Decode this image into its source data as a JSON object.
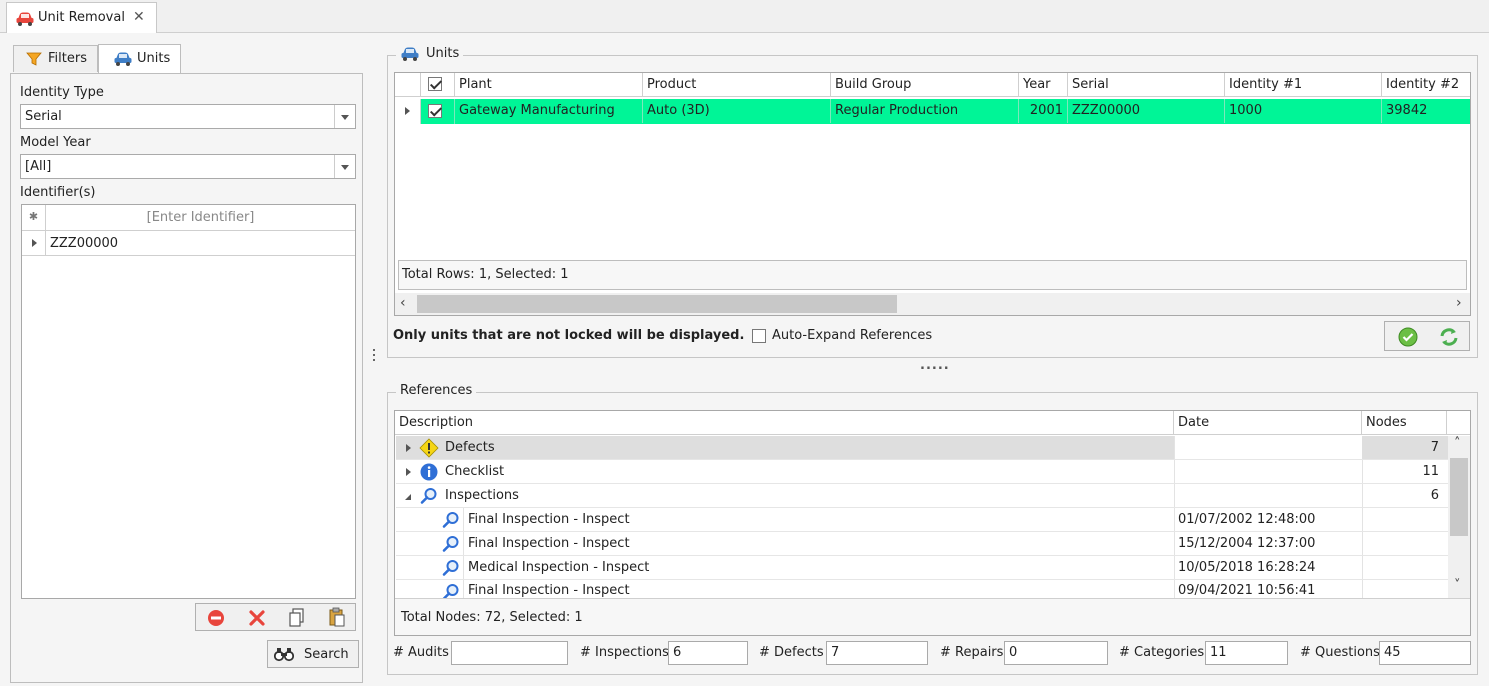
{
  "doc_tab": {
    "title": "Unit Removal",
    "close": "✕"
  },
  "left": {
    "tabs": {
      "filters": "Filters",
      "units": "Units"
    },
    "identity_type": {
      "label": "Identity Type",
      "value": "Serial"
    },
    "model_year": {
      "label": "Model Year",
      "value": "[All]"
    },
    "identifiers": {
      "label": "Identifier(s)",
      "new_row_marker": "✱",
      "placeholder": "[Enter Identifier]",
      "rows": [
        "ZZZ00000"
      ]
    },
    "search_label": "Search"
  },
  "units": {
    "title": "Units",
    "columns": [
      "Plant",
      "Product",
      "Build Group",
      "Year",
      "Serial",
      "Identity #1",
      "Identity #2"
    ],
    "row": {
      "plant": "Gateway Manufacturing",
      "product": "Auto (3D)",
      "build_group": "Regular Production",
      "year": "2001",
      "serial": "ZZZ00000",
      "identity1": "1000",
      "identity2": "39842"
    },
    "status": "Total Rows: 1, Selected: 1",
    "note": "Only units that are not locked will be displayed.",
    "auto_expand_label": "Auto-Expand References",
    "splitter_dots": "....."
  },
  "references": {
    "title": "References",
    "columns": {
      "description": "Description",
      "date": "Date",
      "nodes": "Nodes"
    },
    "groups": [
      {
        "label": "Defects",
        "nodes": "7"
      },
      {
        "label": "Checklist",
        "nodes": "11"
      },
      {
        "label": "Inspections",
        "nodes": "6"
      }
    ],
    "children": [
      {
        "label": "Final Inspection - Inspect",
        "date": "01/07/2002 12:48:00"
      },
      {
        "label": "Final Inspection - Inspect",
        "date": "15/12/2004 12:37:00"
      },
      {
        "label": "Medical Inspection - Inspect",
        "date": "10/05/2018 16:28:24"
      },
      {
        "label": "Final Inspection - Inspect",
        "date": "09/04/2021 10:56:41"
      }
    ],
    "status": "Total Nodes: 72, Selected: 1"
  },
  "summary": {
    "audits": {
      "label": "# Audits",
      "value": ""
    },
    "inspections": {
      "label": "# Inspections",
      "value": "6"
    },
    "defects": {
      "label": "# Defects",
      "value": "7"
    },
    "repairs": {
      "label": "# Repairs",
      "value": "0"
    },
    "categories": {
      "label": "# Categories",
      "value": "11"
    },
    "questions": {
      "label": "# Questions",
      "value": "45"
    }
  },
  "colors": {
    "selected_row": "#00f597",
    "accent_red": "#e8453c",
    "accent_green": "#4caf50"
  }
}
